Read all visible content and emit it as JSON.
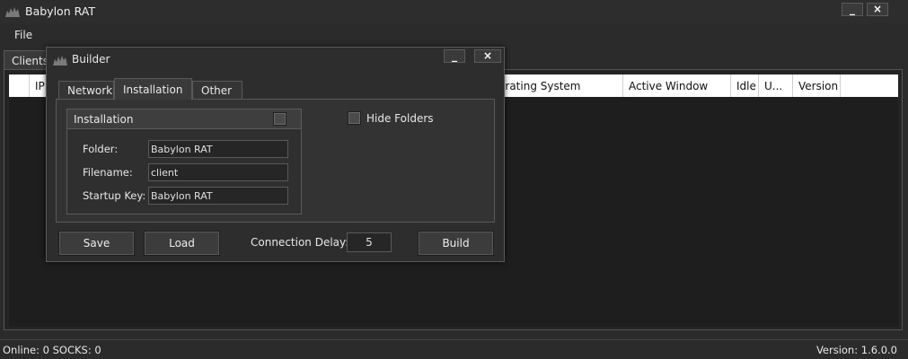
{
  "window": {
    "title": "Babylon RAT",
    "minimize": "_",
    "close": "×"
  },
  "menu": {
    "file": "File"
  },
  "tabs": {
    "clients": "Clients"
  },
  "list": {
    "columns": [
      "IP A",
      "erating System",
      "Active Window",
      "Idle",
      "U...",
      "Version"
    ]
  },
  "status": {
    "left": "Online: 0  SOCKS: 0",
    "right": "Version: 1.6.0.0"
  },
  "builder": {
    "title": "Builder",
    "minimize": "_",
    "close": "×",
    "tabs": {
      "network": "Network",
      "installation": "Installation",
      "other": "Other"
    },
    "installation_group": {
      "title": "Installation",
      "folder_label": "Folder:",
      "folder_value": "Babylon RAT",
      "filename_label": "Filename:",
      "filename_value": "client",
      "startup_label": "Startup Key:",
      "startup_value": "Babylon RAT"
    },
    "hide_folders": "Hide Folders",
    "save": "Save",
    "load": "Load",
    "delay_label": "Connection Delay:",
    "delay_value": "5",
    "build": "Build"
  }
}
